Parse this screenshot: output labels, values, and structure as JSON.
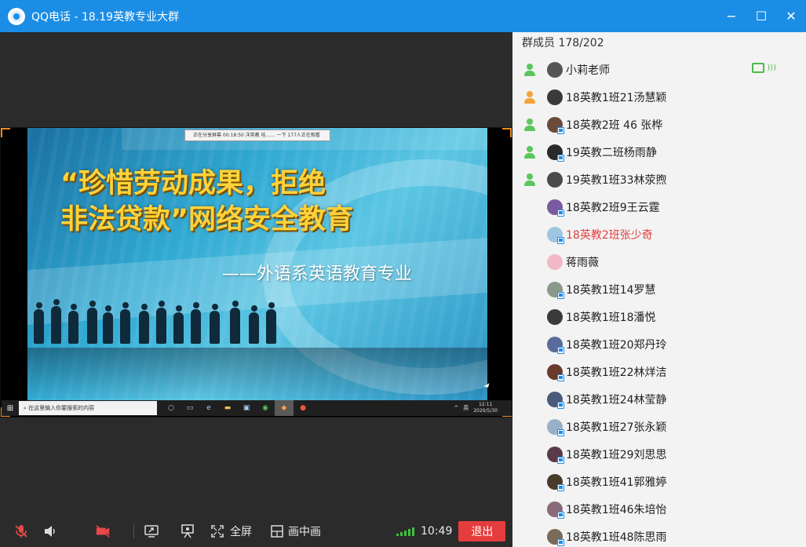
{
  "window": {
    "title": "QQ电话 - 18.19英教专业大群",
    "controls": {
      "minimize": "−",
      "maximize": "☐",
      "close": "✕"
    }
  },
  "slide": {
    "recording_bar": "正在分享屏幕  00:18:50  洋英教  哇…… 一下 177人正在观看",
    "title_line1": "“珍惜劳动成果，拒绝",
    "title_line2": "非法贷款”网络安全教育",
    "subtitle": "——外语系英语教育专业"
  },
  "desktop_taskbar": {
    "search_placeholder": "在这里输入你要搜索的内容",
    "tray_text": "英",
    "clock_time": "12:11",
    "clock_date": "2020/5/30"
  },
  "toolbar": {
    "fullscreen_label": "全屏",
    "pip_label": "画中画",
    "call_time": "10:49",
    "exit_label": "退出",
    "colors": {
      "exit": "#e53d3d",
      "signal": "#3ec23e",
      "mic_off": "#e84848"
    }
  },
  "members": {
    "header": "群成员 178/202",
    "items": [
      {
        "name": "小莉老师",
        "mic": "green",
        "avatar_color": "#555555",
        "sharing": true,
        "device": false
      },
      {
        "name": "18英教1班21汤慧颖",
        "mic": "orange",
        "avatar_color": "#3a3a3a",
        "sharing": false,
        "device": false
      },
      {
        "name": "18英教2班 46 张桦",
        "mic": "green",
        "avatar_color": "#6b4a3a",
        "sharing": false,
        "device": true
      },
      {
        "name": "19英教二班杨雨静",
        "mic": "green",
        "avatar_color": "#2a2a2a",
        "sharing": false,
        "device": true
      },
      {
        "name": "19英教1班33林荥煦",
        "mic": "green",
        "avatar_color": "#4a4a4a",
        "sharing": false,
        "device": false
      },
      {
        "name": "18英教2班9王云霆",
        "mic": "none",
        "avatar_color": "#7a5aa0",
        "sharing": false,
        "device": true
      },
      {
        "name": "18英教2班张少奇",
        "mic": "none",
        "avatar_color": "#9fc6e0",
        "sharing": false,
        "device": true,
        "highlight": "#e53d3d"
      },
      {
        "name": "蒋雨薇",
        "mic": "none",
        "avatar_color": "#f2b8c8",
        "sharing": false,
        "device": false
      },
      {
        "name": "18英教1班14罗慧",
        "mic": "none",
        "avatar_color": "#8a9a8a",
        "sharing": false,
        "device": true
      },
      {
        "name": "18英教1班18潘悦",
        "mic": "none",
        "avatar_color": "#3a3a3a",
        "sharing": false,
        "device": false
      },
      {
        "name": "18英教1班20郑丹玲",
        "mic": "none",
        "avatar_color": "#5a6a9a",
        "sharing": false,
        "device": true
      },
      {
        "name": "18英教1班22林烊洁",
        "mic": "none",
        "avatar_color": "#6a3a2a",
        "sharing": false,
        "device": true
      },
      {
        "name": "18英教1班24林莹静",
        "mic": "none",
        "avatar_color": "#4a5a7a",
        "sharing": false,
        "device": true
      },
      {
        "name": "18英教1班27张永颖",
        "mic": "none",
        "avatar_color": "#9ab0c8",
        "sharing": false,
        "device": true
      },
      {
        "name": "18英教1班29刘思思",
        "mic": "none",
        "avatar_color": "#5a3a4a",
        "sharing": false,
        "device": true
      },
      {
        "name": "18英教1班41郭雅婷",
        "mic": "none",
        "avatar_color": "#4a3a2a",
        "sharing": false,
        "device": true
      },
      {
        "name": "18英教1班46朱培怡",
        "mic": "none",
        "avatar_color": "#8a6a7a",
        "sharing": false,
        "device": true
      },
      {
        "name": "18英教1班48陈思雨",
        "mic": "none",
        "avatar_color": "#7a6a5a",
        "sharing": false,
        "device": true
      }
    ]
  }
}
